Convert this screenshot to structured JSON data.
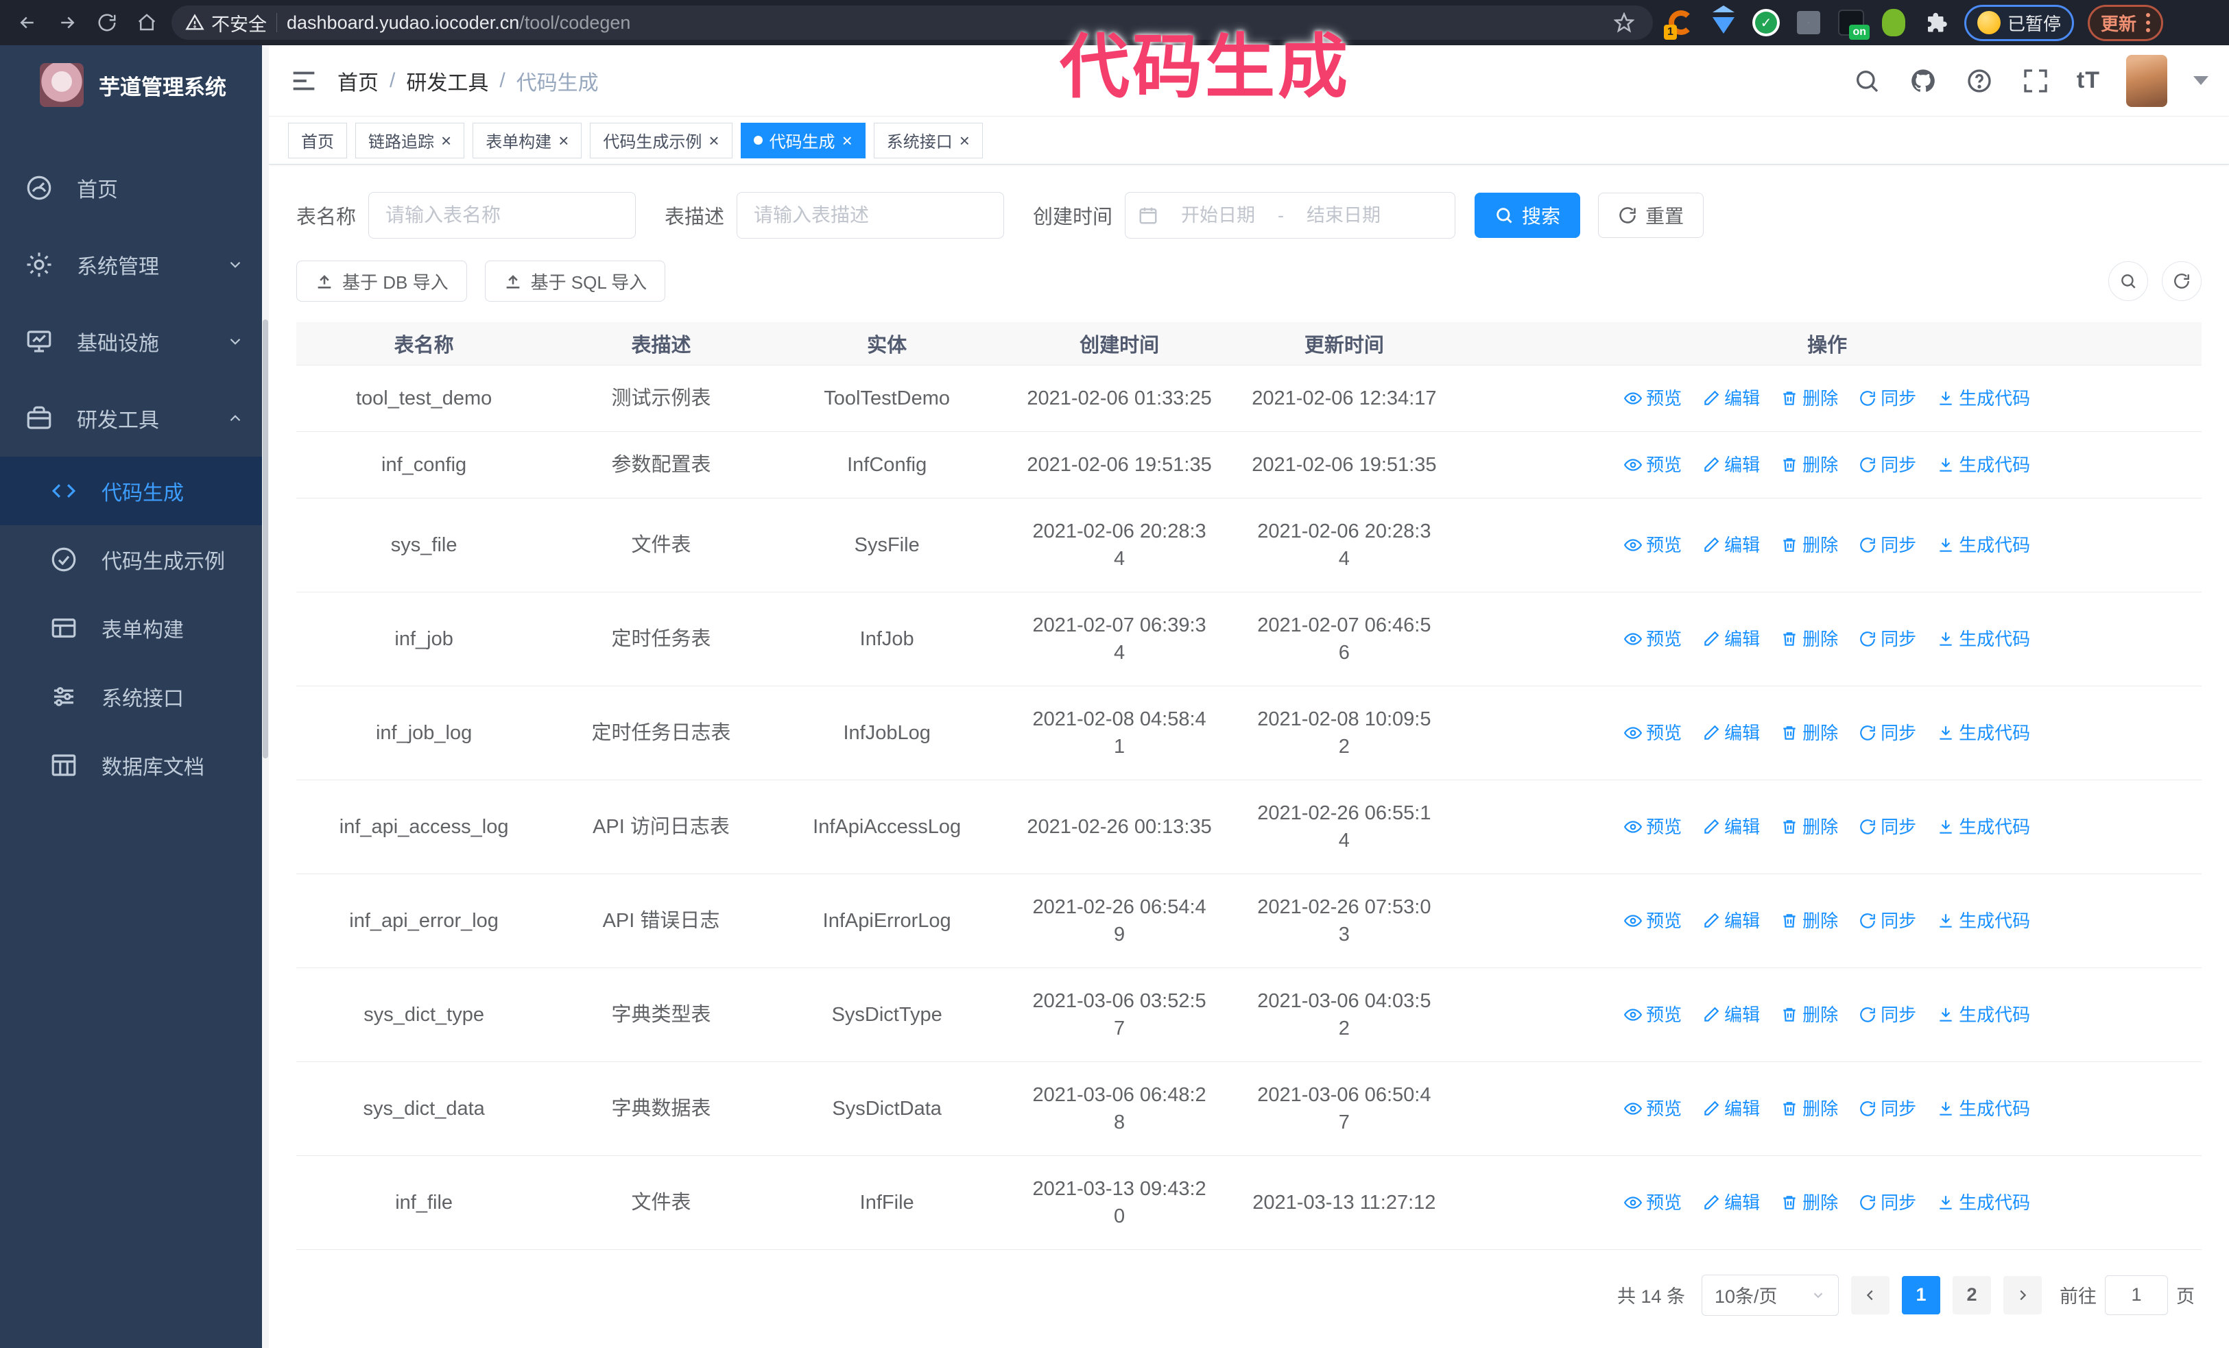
{
  "browser": {
    "security_label": "不安全",
    "url_domain": "dashboard.yudao.iocoder.cn",
    "url_path": "/tool/codegen",
    "extension_badge": "1",
    "extension_on_badge": "on",
    "paused_chip": "已暂停",
    "update_chip": "更新"
  },
  "annotation": {
    "text": "代码生成",
    "color": "#f43f6c"
  },
  "sidebar": {
    "title": "芋道管理系统",
    "items": [
      {
        "label": "首页"
      },
      {
        "label": "系统管理"
      },
      {
        "label": "基础设施"
      },
      {
        "label": "研发工具"
      }
    ],
    "subitems": [
      {
        "label": "代码生成"
      },
      {
        "label": "代码生成示例"
      },
      {
        "label": "表单构建"
      },
      {
        "label": "系统接口"
      },
      {
        "label": "数据库文档"
      }
    ]
  },
  "navbar": {
    "breadcrumb": [
      "首页",
      "研发工具",
      "代码生成"
    ],
    "separator": "/"
  },
  "tabs": [
    {
      "label": "首页"
    },
    {
      "label": "链路追踪"
    },
    {
      "label": "表单构建"
    },
    {
      "label": "代码生成示例"
    },
    {
      "label": "代码生成"
    },
    {
      "label": "系统接口"
    }
  ],
  "search_form": {
    "table_name_label": "表名称",
    "table_name_placeholder": "请输入表名称",
    "table_desc_label": "表描述",
    "table_desc_placeholder": "请输入表描述",
    "create_time_label": "创建时间",
    "start_date_placeholder": "开始日期",
    "range_separator": "-",
    "end_date_placeholder": "结束日期",
    "search_button": "搜索",
    "reset_button": "重置"
  },
  "toolbar": {
    "import_db_button": "基于 DB 导入",
    "import_sql_button": "基于 SQL 导入"
  },
  "table": {
    "columns": [
      "表名称",
      "表描述",
      "实体",
      "创建时间",
      "更新时间",
      "操作"
    ],
    "actions": [
      "预览",
      "编辑",
      "删除",
      "同步",
      "生成代码"
    ],
    "rows": [
      {
        "name": "tool_test_demo",
        "desc": "测试示例表",
        "entity": "ToolTestDemo",
        "created": "2021-02-06 01:33:25",
        "updated": "2021-02-06 12:34:17"
      },
      {
        "name": "inf_config",
        "desc": "参数配置表",
        "entity": "InfConfig",
        "created": "2021-02-06 19:51:35",
        "updated": "2021-02-06 19:51:35"
      },
      {
        "name": "sys_file",
        "desc": "文件表",
        "entity": "SysFile",
        "created": "2021-02-06 20:28:3\n4",
        "updated": "2021-02-06 20:28:3\n4"
      },
      {
        "name": "inf_job",
        "desc": "定时任务表",
        "entity": "InfJob",
        "created": "2021-02-07 06:39:3\n4",
        "updated": "2021-02-07 06:46:5\n6"
      },
      {
        "name": "inf_job_log",
        "desc": "定时任务日志表",
        "entity": "InfJobLog",
        "created": "2021-02-08 04:58:4\n1",
        "updated": "2021-02-08 10:09:5\n2"
      },
      {
        "name": "inf_api_access_log",
        "desc": "API 访问日志表",
        "entity": "InfApiAccessLog",
        "created": "2021-02-26 00:13:35",
        "updated": "2021-02-26 06:55:1\n4"
      },
      {
        "name": "inf_api_error_log",
        "desc": "API 错误日志",
        "entity": "InfApiErrorLog",
        "created": "2021-02-26 06:54:4\n9",
        "updated": "2021-02-26 07:53:0\n3"
      },
      {
        "name": "sys_dict_type",
        "desc": "字典类型表",
        "entity": "SysDictType",
        "created": "2021-03-06 03:52:5\n7",
        "updated": "2021-03-06 04:03:5\n2"
      },
      {
        "name": "sys_dict_data",
        "desc": "字典数据表",
        "entity": "SysDictData",
        "created": "2021-03-06 06:48:2\n8",
        "updated": "2021-03-06 06:50:4\n7"
      },
      {
        "name": "inf_file",
        "desc": "文件表",
        "entity": "InfFile",
        "created": "2021-03-13 09:43:2\n0",
        "updated": "2021-03-13 11:27:12"
      }
    ]
  },
  "pagination": {
    "total_label": "共 14 条",
    "page_size": "10条/页",
    "page_1": "1",
    "page_2": "2",
    "goto_label": "前往",
    "goto_value": "1",
    "goto_suffix": "页"
  },
  "colors": {
    "accent": "#1890ff",
    "sidebar_bg": "#2c3e57",
    "sidebar_text": "#bfcbd9",
    "active_menu_text": "#3d9eff",
    "annotation_pink": "#f43f6c",
    "table_header_bg": "#f8f8f9"
  }
}
